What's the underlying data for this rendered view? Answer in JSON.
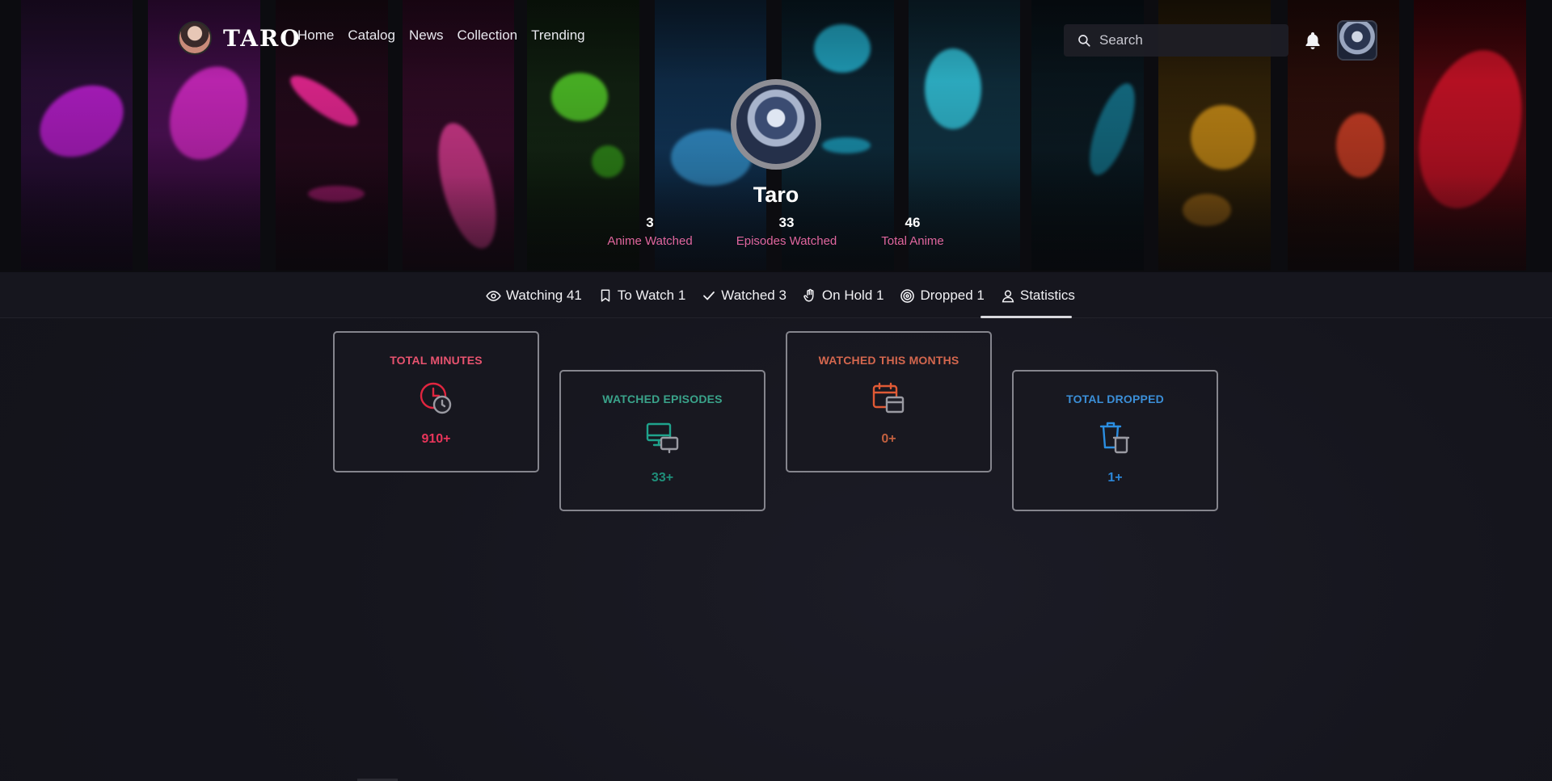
{
  "nav": {
    "logo": "TARO",
    "links": [
      "Home",
      "Catalog",
      "News",
      "Collection",
      "Trending"
    ],
    "search_placeholder": "Search"
  },
  "profile": {
    "name": "Taro",
    "stats": [
      {
        "value": "3",
        "label": "Anime Watched"
      },
      {
        "value": "33",
        "label": "Episodes Watched"
      },
      {
        "value": "46",
        "label": "Total Anime"
      }
    ]
  },
  "tabs": [
    {
      "label": "Watching 41",
      "icon": "eye-icon"
    },
    {
      "label": "To Watch 1",
      "icon": "bookmark-icon"
    },
    {
      "label": "Watched 3",
      "icon": "check-icon"
    },
    {
      "label": "On Hold 1",
      "icon": "hand-icon"
    },
    {
      "label": "Dropped 1",
      "icon": "target-icon"
    },
    {
      "label": "Statistics",
      "icon": "user-icon",
      "active": true
    }
  ],
  "cards": [
    {
      "title": "TOTAL MINUTES",
      "value": "910+",
      "color": "#e8536f",
      "icon": "clock-icon"
    },
    {
      "title": "WATCHED EPISODES",
      "value": "33+",
      "color": "#3aa38a",
      "icon": "monitor-icon"
    },
    {
      "title": "WATCHED THIS MONTHS",
      "value": "0+",
      "color": "#d4674e",
      "icon": "calendar-icon"
    },
    {
      "title": "TOTAL DROPPED",
      "value": "1+",
      "color": "#3b8fd8",
      "icon": "trash-icon"
    }
  ],
  "colors": {
    "accent_pink": "#e0669e",
    "background": "#15151d"
  }
}
